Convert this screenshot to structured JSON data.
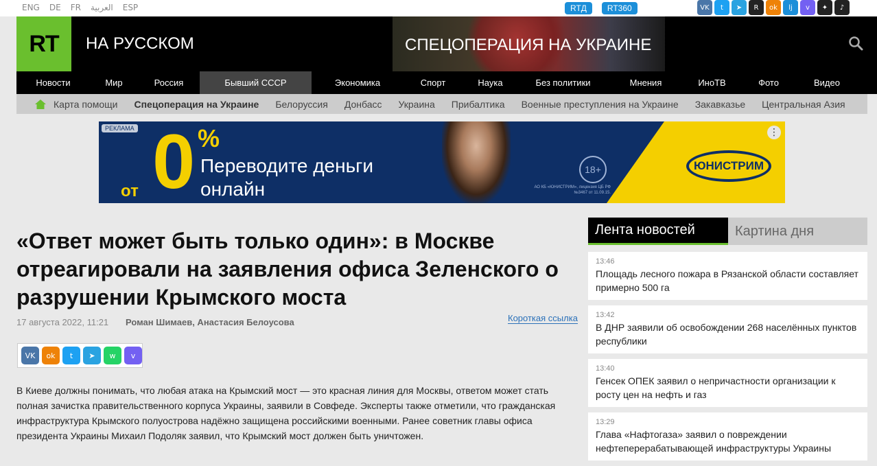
{
  "top": {
    "languages": [
      "ENG",
      "DE",
      "FR",
      "العربية",
      "ESP"
    ],
    "pills": [
      "RTД",
      "RT360"
    ],
    "socials": [
      {
        "name": "vk",
        "label": "VK",
        "color": "#4a76a8"
      },
      {
        "name": "twitter",
        "label": "t",
        "color": "#1da1f2"
      },
      {
        "name": "telegram",
        "label": "➤",
        "color": "#2aa3e1"
      },
      {
        "name": "rutube",
        "label": "R",
        "color": "#222"
      },
      {
        "name": "odnoklassniki",
        "label": "ok",
        "color": "#ee8208"
      },
      {
        "name": "livejournal",
        "label": "lj",
        "color": "#1c8fd9"
      },
      {
        "name": "viber",
        "label": "v",
        "color": "#7360f2"
      },
      {
        "name": "zen",
        "label": "✦",
        "color": "#222"
      },
      {
        "name": "tiktok",
        "label": "♪",
        "color": "#222"
      }
    ]
  },
  "header": {
    "logo": "RT",
    "site_name": "НА РУССКОМ",
    "special_banner": "СПЕЦОПЕРАЦИЯ НА УКРАИНЕ"
  },
  "nav": {
    "items": [
      "Новости",
      "Мир",
      "Россия",
      "Бывший СССР",
      "Экономика",
      "Спорт",
      "Наука",
      "Без политики",
      "Мнения",
      "ИноТВ",
      "Фото",
      "Видео"
    ],
    "active": "Бывший СССР"
  },
  "subnav": {
    "items": [
      "Карта помощи",
      "Спецоперация на Украине",
      "Белоруссия",
      "Донбасс",
      "Украина",
      "Прибалтика",
      "Военные преступления на Украине",
      "Закавказье",
      "Центральная Азия"
    ]
  },
  "ad": {
    "tag": "РЕКЛАМА",
    "prefix": "от",
    "big": "0",
    "percent": "%",
    "text": "Переводите деньги онлайн",
    "age": "18+",
    "brand": "ЮНИСТРИМ",
    "license": "АО КБ «ЮНИСТРИМ», лицензия ЦБ РФ №3467 от 11.09.15."
  },
  "article": {
    "title": "«Ответ может быть только один»: в Москве отреагировали на заявления офиса Зеленского о разрушении Крымского моста",
    "date": "17 августа 2022, 11:21",
    "authors": "Роман Шимаев, Анастасия Белоусова",
    "short_link": "Короткая ссылка",
    "share": [
      {
        "name": "vk",
        "label": "VK",
        "color": "#4a76a8"
      },
      {
        "name": "odnoklassniki",
        "label": "ok",
        "color": "#ee8208"
      },
      {
        "name": "twitter",
        "label": "t",
        "color": "#1da1f2"
      },
      {
        "name": "telegram",
        "label": "➤",
        "color": "#2aa3e1"
      },
      {
        "name": "whatsapp",
        "label": "w",
        "color": "#25d366"
      },
      {
        "name": "viber",
        "label": "v",
        "color": "#7360f2"
      }
    ],
    "lead": "В Киеве должны понимать, что любая атака на Крымский мост — это красная линия для Москвы, ответом может стать полная зачистка правительственного корпуса Украины, заявили в Совфеде. Эксперты также отметили, что гражданская инфраструктура Крымского полуострова надёжно защищена российскими военными. Ранее советник главы офиса президента Украины Михаил Подоляк заявил, что Крымский мост должен быть уничтожен."
  },
  "sidebar": {
    "tabs": [
      "Лента новостей",
      "Картина дня"
    ],
    "news": [
      {
        "time": "13:46",
        "text": "Площадь лесного пожара в Рязанской области составляет примерно 500 га"
      },
      {
        "time": "13:42",
        "text": "В ДНР заявили об освобождении 268 населённых пунктов республики"
      },
      {
        "time": "13:40",
        "text": "Генсек ОПЕК заявил о непричастности организации к росту цен на нефть и газ"
      },
      {
        "time": "13:29",
        "text": "Глава «Нафтогаза» заявил о повреждении нефтеперерабатывающей инфраструктуры Украины"
      }
    ]
  }
}
